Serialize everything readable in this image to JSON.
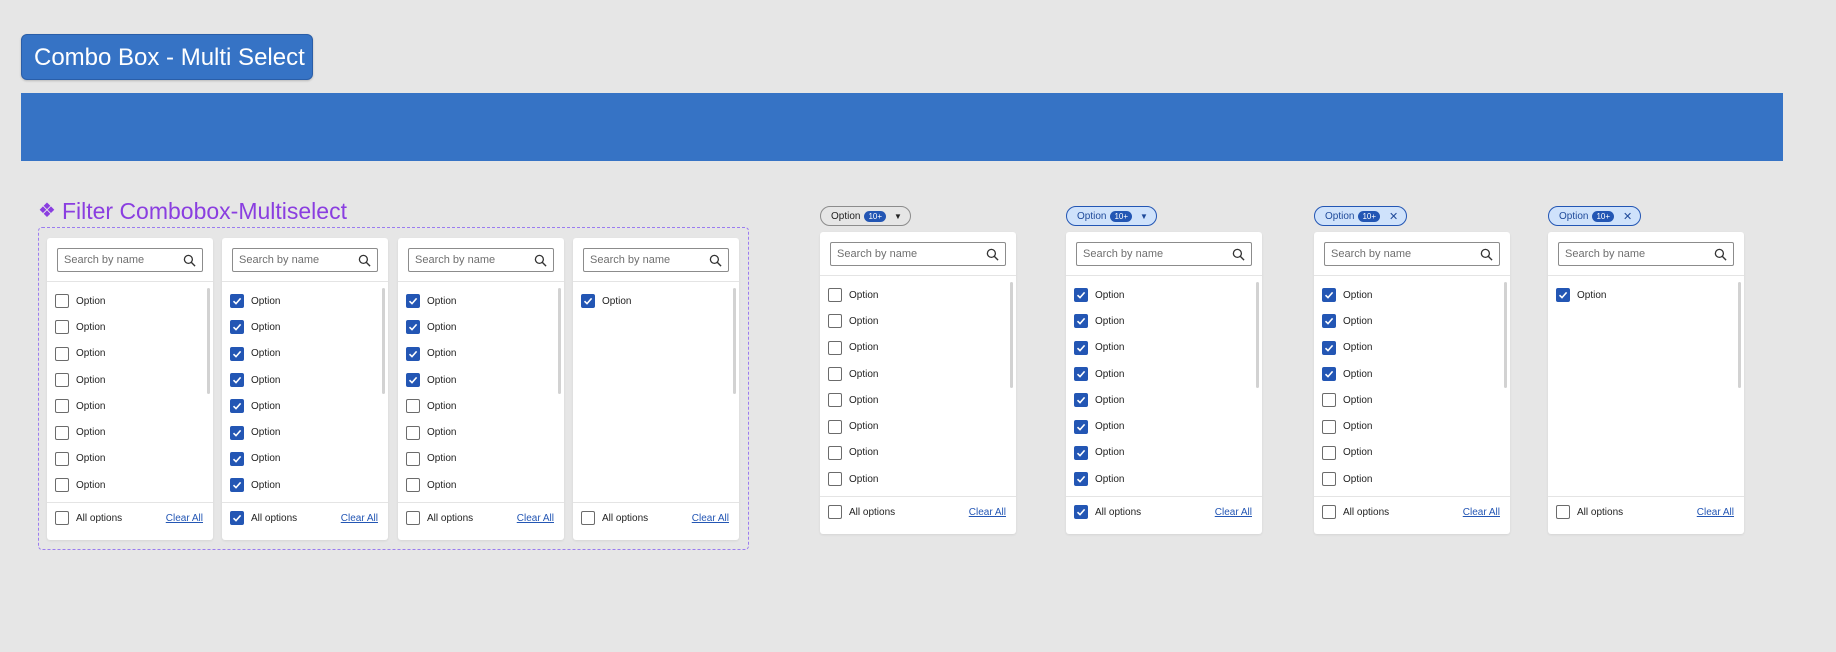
{
  "header": {
    "title": "Combo Box - Multi Select"
  },
  "component": {
    "title": "Filter Combobox-Multiselect"
  },
  "common": {
    "search_placeholder": "Search by name",
    "option_label": "Option",
    "all_options_label": "All options",
    "clear_all_label": "Clear All",
    "chip_label": "Option",
    "chip_count": "10+"
  },
  "panels": [
    {
      "checked": [
        false,
        false,
        false,
        false,
        false,
        false,
        false,
        false
      ],
      "all_checked": false
    },
    {
      "checked": [
        true,
        true,
        true,
        true,
        true,
        true,
        true,
        true
      ],
      "all_checked": true
    },
    {
      "checked": [
        true,
        true,
        true,
        true,
        false,
        false,
        false,
        false
      ],
      "all_checked": false
    },
    {
      "checked": [
        true
      ],
      "all_checked": false
    },
    {
      "checked": [
        false,
        false,
        false,
        false,
        false,
        false,
        false,
        false
      ],
      "all_checked": false,
      "chip_state": "neutral-caret"
    },
    {
      "checked": [
        true,
        true,
        true,
        true,
        true,
        true,
        true,
        true
      ],
      "all_checked": true,
      "chip_state": "active-caret"
    },
    {
      "checked": [
        true,
        true,
        true,
        true,
        false,
        false,
        false,
        false
      ],
      "all_checked": false,
      "chip_state": "active-clear"
    },
    {
      "checked": [
        true
      ],
      "all_checked": false,
      "chip_state": "active-clear"
    }
  ],
  "colors": {
    "brand_blue": "#3673c5",
    "check_blue": "#2356b4",
    "component_purple": "#8a3ee0",
    "chip_active_bg": "#cfe2fb"
  },
  "icons": [
    "search-icon",
    "check-icon",
    "caret-down-icon",
    "close-icon",
    "component-diamond-icon"
  ]
}
